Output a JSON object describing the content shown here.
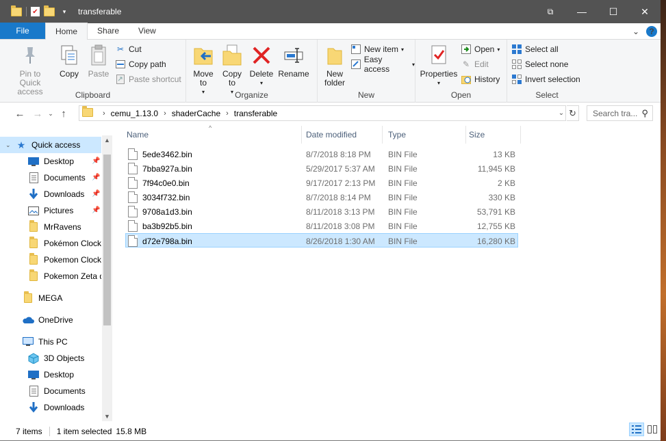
{
  "window": {
    "title": "transferable",
    "controls": {
      "minimize": "—",
      "maximize": "☐",
      "close": "✕"
    }
  },
  "ribbon_tabs": [
    {
      "label": "File"
    },
    {
      "label": "Home"
    },
    {
      "label": "Share"
    },
    {
      "label": "View"
    }
  ],
  "clipboard": {
    "pin": "Pin to Quick access",
    "copy": "Copy",
    "paste": "Paste",
    "cut": "Cut",
    "copy_path": "Copy path",
    "paste_shortcut": "Paste shortcut",
    "label": "Clipboard"
  },
  "organize": {
    "move_to": "Move to",
    "copy_to": "Copy to",
    "delete": "Delete",
    "rename": "Rename",
    "label": "Organize"
  },
  "new": {
    "new_folder": "New folder",
    "new_item": "New item",
    "easy_access": "Easy access",
    "label": "New"
  },
  "open": {
    "properties": "Properties",
    "open": "Open",
    "edit": "Edit",
    "history": "History",
    "label": "Open"
  },
  "select": {
    "select_all": "Select all",
    "select_none": "Select none",
    "invert_selection": "Invert selection",
    "label": "Select"
  },
  "address": {
    "crumbs": [
      "cemu_1.13.0",
      "shaderCache",
      "transferable"
    ],
    "search_placeholder": "Search tra..."
  },
  "nav": {
    "quick_access": "Quick access",
    "items": [
      {
        "label": "Desktop",
        "icon": "desktop-icon"
      },
      {
        "label": "Documents",
        "icon": "documents-icon"
      },
      {
        "label": "Downloads",
        "icon": "downloads-icon"
      },
      {
        "label": "Pictures",
        "icon": "pictures-icon"
      },
      {
        "label": "MrRavens",
        "icon": "folder-icon"
      },
      {
        "label": "Pokémon Clockwork",
        "icon": "folder-icon"
      },
      {
        "label": "Pokemon Clockwork",
        "icon": "folder-icon"
      },
      {
        "label": "Pokemon Zeta dex",
        "icon": "folder-icon"
      }
    ],
    "mega": "MEGA",
    "onedrive": "OneDrive",
    "this_pc": "This PC",
    "pc_items": [
      {
        "label": "3D Objects"
      },
      {
        "label": "Desktop"
      },
      {
        "label": "Documents"
      },
      {
        "label": "Downloads"
      }
    ]
  },
  "columns": {
    "name": "Name",
    "date": "Date modified",
    "type": "Type",
    "size": "Size"
  },
  "files": [
    {
      "name": "5ede3462.bin",
      "date": "8/7/2018 8:18 PM",
      "type": "BIN File",
      "size": "13 KB"
    },
    {
      "name": "7bba927a.bin",
      "date": "5/29/2017 5:37 AM",
      "type": "BIN File",
      "size": "11,945 KB"
    },
    {
      "name": "7f94c0e0.bin",
      "date": "9/17/2017 2:13 PM",
      "type": "BIN File",
      "size": "2 KB"
    },
    {
      "name": "3034f732.bin",
      "date": "8/7/2018 8:14 PM",
      "type": "BIN File",
      "size": "330 KB"
    },
    {
      "name": "9708a1d3.bin",
      "date": "8/11/2018 3:13 PM",
      "type": "BIN File",
      "size": "53,791 KB"
    },
    {
      "name": "ba3b92b5.bin",
      "date": "8/11/2018 3:08 PM",
      "type": "BIN File",
      "size": "12,755 KB"
    },
    {
      "name": "d72e798a.bin",
      "date": "8/26/2018 1:30 AM",
      "type": "BIN File",
      "size": "16,280 KB"
    }
  ],
  "status": {
    "items": "7 items",
    "selected": "1 item selected",
    "size": "15.8 MB"
  }
}
